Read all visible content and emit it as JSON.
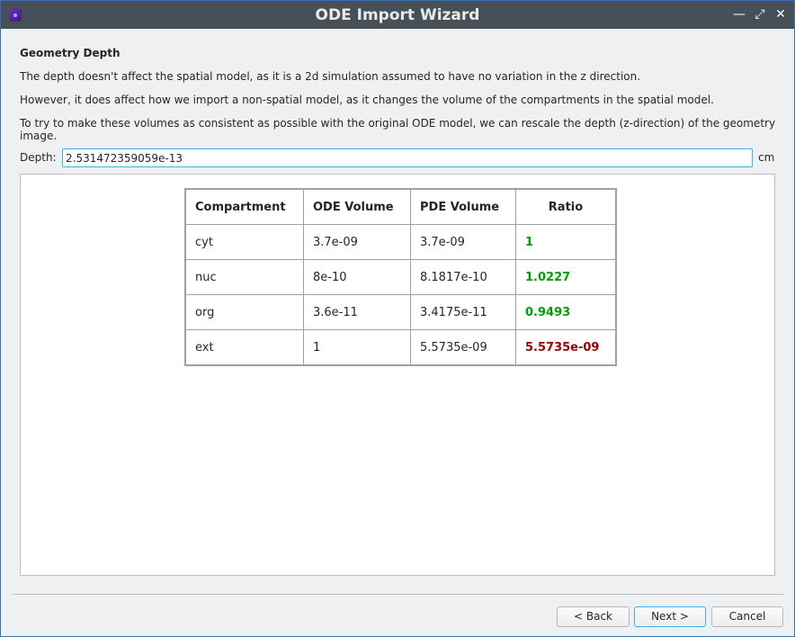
{
  "window": {
    "title": "ODE Import Wizard"
  },
  "titlebar_icons": {
    "app": "app-icon",
    "minimize": "minimize-icon",
    "maximize": "maximize-icon",
    "close": "close-icon"
  },
  "page": {
    "heading": "Geometry Depth",
    "paragraph1": "The depth doesn't affect the spatial model, as it is a 2d simulation assumed to have no variation in the z direction.",
    "paragraph2": "However, it does affect how we import a non-spatial model, as it changes the volume of the compartments in the spatial model.",
    "paragraph3": "To try to make these volumes as consistent as possible with the original ODE model, we can rescale the depth (z-direction) of the geometry image."
  },
  "depth": {
    "label": "Depth:",
    "value": "2.531472359059e-13",
    "unit": "cm"
  },
  "table": {
    "headers": [
      "Compartment",
      "ODE Volume",
      "PDE Volume",
      "Ratio"
    ],
    "rows": [
      {
        "compartment": "cyt",
        "ode": "3.7e-09",
        "pde": "3.7e-09",
        "ratio": "1",
        "status": "ok"
      },
      {
        "compartment": "nuc",
        "ode": "8e-10",
        "pde": "8.1817e-10",
        "ratio": "1.0227",
        "status": "ok"
      },
      {
        "compartment": "org",
        "ode": "3.6e-11",
        "pde": "3.4175e-11",
        "ratio": "0.9493",
        "status": "ok"
      },
      {
        "compartment": "ext",
        "ode": "1",
        "pde": "5.5735e-09",
        "ratio": "5.5735e-09",
        "status": "bad"
      }
    ],
    "colors": {
      "ok": "#00a000",
      "bad": "#a00000"
    }
  },
  "buttons": {
    "back": "< Back",
    "next": "Next >",
    "cancel": "Cancel"
  }
}
